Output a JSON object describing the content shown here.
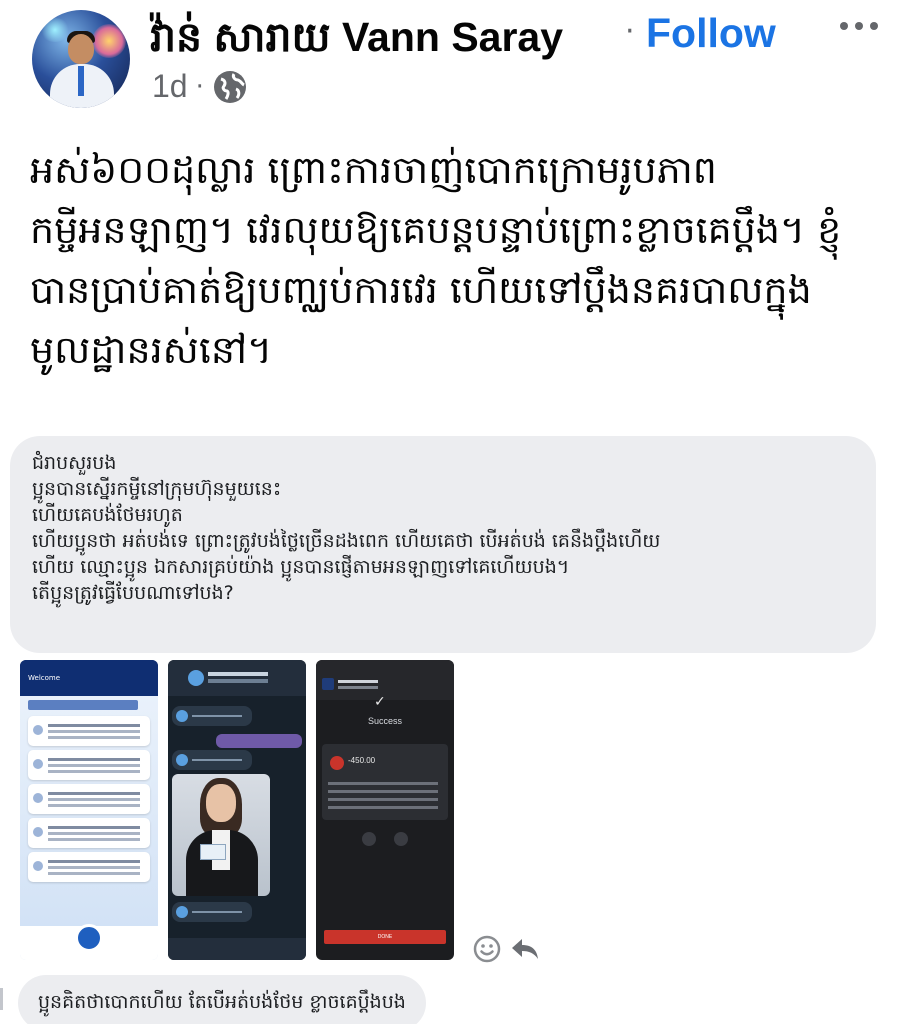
{
  "post": {
    "author": "វ៉ាន់ សារាយ  Vann Saray",
    "separator": "·",
    "follow_label": "Follow",
    "time": "1d",
    "time_separator": "·",
    "privacy_icon": "globe-icon",
    "more_icon": "more-horizontal-icon",
    "text": "អស់៦០០ដុល្លារ ព្រោះការចាញ់បោកក្រោមរូបភាពកម្ចីអនឡាញ។ វេរលុយឱ្យគេបន្តបន្ទាប់ព្រោះខ្លាចគេប្ដឹង។ ខ្ញុំបានប្រាប់គាត់ឱ្យបញ្ឈប់ការវេរ ហើយទៅប្ដឹងនគរបាលក្នុងមូលដ្ឋានរស់នៅ។"
  },
  "message": {
    "lines": [
      "ជំរាបសួរបង",
      "ប្អូនបានស្នើរកម្ចីនៅក្រុមហ៊ុនមួយនេះ",
      "ហើយគេបង់ថែមរហូត",
      "ហើយប្អូនថា អត់បង់ទេ ព្រោះត្រូវបង់ថ្លៃច្រើនដងពេក ហើយគេថា បើអត់បង់ គេនឹងប្ដឹងហើយ",
      "ហើយ ឈ្មោះប្អូន ឯកសារគ្រប់យ៉ាង ប្អូនបានផ្ញើតាមអនឡាញទៅគេហើយបង។",
      "តើប្អូនត្រូវធ្វើបែបណាទៅបង?"
    ]
  },
  "screenshots": {
    "shot1_header": "Welcome",
    "shot3_success": "Success",
    "shot3_amount": "-450.00",
    "shot3_done": "DONE"
  },
  "actions": {
    "react_icon": "smiley-icon",
    "reply_icon": "reply-arrow-icon"
  },
  "comment": {
    "text": "ប្អូនគិតថាបោកហើយ តែបើអត់បង់ថែម ខ្លាចគេប្ដឹងបង"
  },
  "colors": {
    "accent": "#1b74e4",
    "bubble": "#ecedf0",
    "secondary_text": "#65676b"
  }
}
